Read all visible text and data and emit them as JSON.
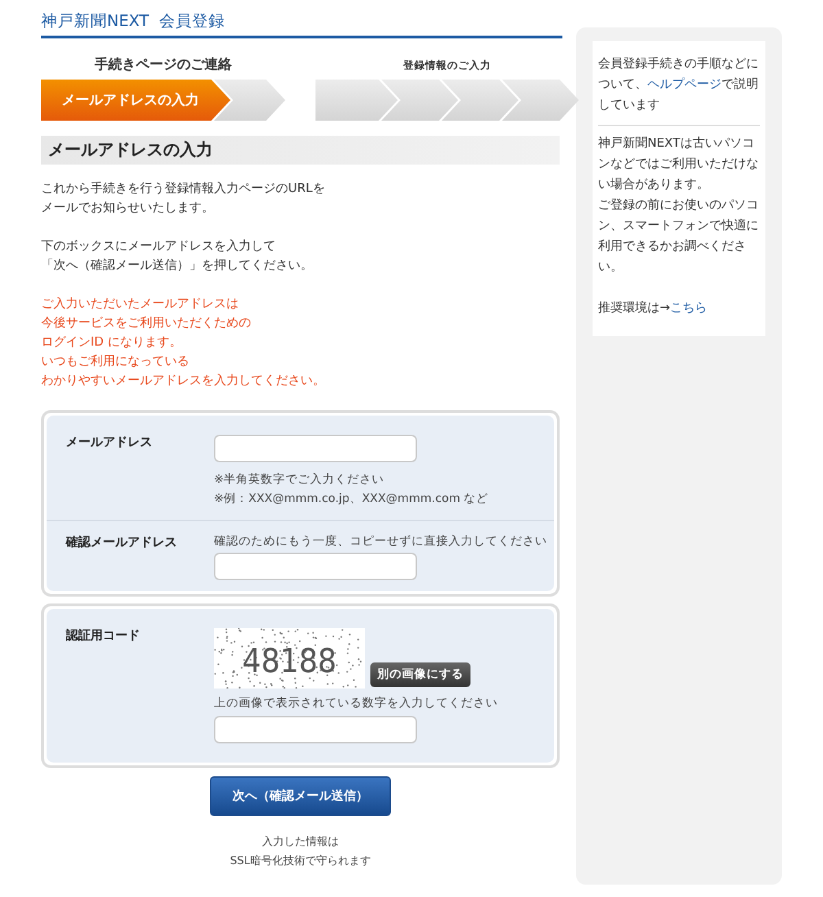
{
  "header": {
    "title": "神戸新聞NEXT  会員登録"
  },
  "step_groups": [
    {
      "label": "手続きページのご連絡",
      "steps": [
        {
          "label": "メールアドレスの入力",
          "selected": true
        },
        {
          "selected": false
        }
      ]
    },
    {
      "label": "登録情報のご入力",
      "steps": [
        {
          "selected": false
        },
        {
          "selected": false
        },
        {
          "selected": false
        },
        {
          "selected": false
        }
      ]
    }
  ],
  "section_title": "メールアドレスの入力",
  "paragraphs": [
    {
      "kind": "normal",
      "lines": [
        "これから手続きを行う登録情報入力ページのURLを",
        "メールでお知らせいたします。"
      ]
    },
    {
      "kind": "normal",
      "lines": [
        "下のボックスにメールアドレスを入力して",
        "「次へ（確認メール送信）」を押してください。"
      ]
    },
    {
      "kind": "warning",
      "lines": [
        "ご入力いただいたメールアドレスは",
        "今後サービスをご利用いただくための",
        "ログインID になります。",
        "いつもご利用になっている",
        "わかりやすいメールアドレスを入力してください。"
      ]
    }
  ],
  "email_form": [
    {
      "label": "メールアドレス",
      "notes": [
        "※半角英数字でご入力ください",
        "※例：XXX@mmm.co.jp、XXX@mmm.com など"
      ]
    },
    {
      "label": "確認メールアドレス",
      "note_before": "確認のためにもう一度、コピーせずに直接入力してください"
    }
  ],
  "captcha": {
    "label": "認証用コード",
    "code": "48188",
    "refresh_button": "別の画像にする",
    "instruction": "上の画像で表示されている数字を入力してください"
  },
  "submit_button": "次へ（確認メール送信）",
  "ssl_note": [
    "入力した情報は",
    "SSL暗号化技術で守られます"
  ],
  "sidebar": {
    "help": {
      "before": "会員登録手続きの手順などについて、",
      "link": "ヘルプページ",
      "after": "で説明しています"
    },
    "notice": [
      "神戸新聞NEXTは古いパソコンなどではご利用いただけない場合があります。",
      "ご登録の前にお使いのパソコン、スマートフォンで快適に利用できるかお調べください。"
    ],
    "env": {
      "before": "推奨環境は→",
      "link": "こちら"
    }
  }
}
